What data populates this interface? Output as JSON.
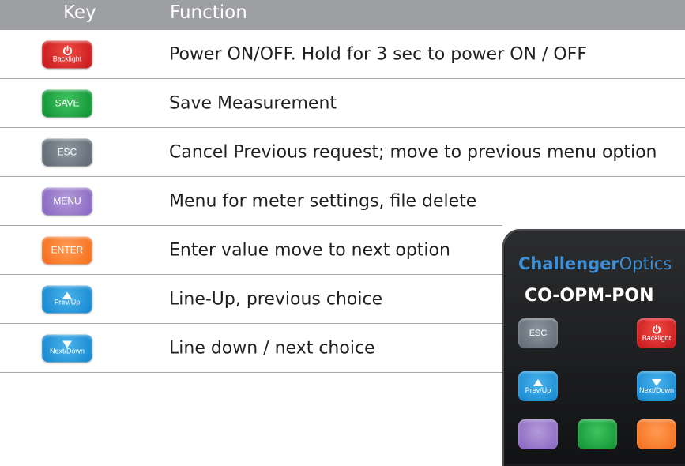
{
  "header": {
    "key_label": "Key",
    "function_label": "Function"
  },
  "rows": [
    {
      "key_main": "",
      "key_sub": "Backlight",
      "key_icon": "power-icon",
      "key_color": "#d61f26",
      "function": "Power ON/OFF. Hold for 3 sec to power ON / OFF"
    },
    {
      "key_main": "SAVE",
      "key_color": "#1fa146",
      "function": "Save Measurement"
    },
    {
      "key_main": "ESC",
      "key_color": "#6e7881",
      "function": "Cancel Previous request; move to previous menu option"
    },
    {
      "key_main": "MENU",
      "key_color": "#9577cc",
      "function": "Menu for meter settings, file delete"
    },
    {
      "key_main": "ENTER",
      "key_color": "#f47b29",
      "function": "Enter value move to next option"
    },
    {
      "key_main": "",
      "key_sub": "Prev/Up",
      "key_icon": "triangle-up-icon",
      "key_color": "#1a94dd",
      "function": "Line-Up, previous choice"
    },
    {
      "key_main": "",
      "key_sub": "Next/Down",
      "key_icon": "triangle-down-icon",
      "key_color": "#1a94dd",
      "function": "Line down / next choice"
    }
  ],
  "device": {
    "brand_part1": "Challenger",
    "brand_part2": "Optics",
    "model": "CO-OPM-PON",
    "esc_label": "ESC",
    "backlight_label": "Backlight",
    "prev_label": "Prev/Up",
    "next_label": "Next/Down"
  }
}
